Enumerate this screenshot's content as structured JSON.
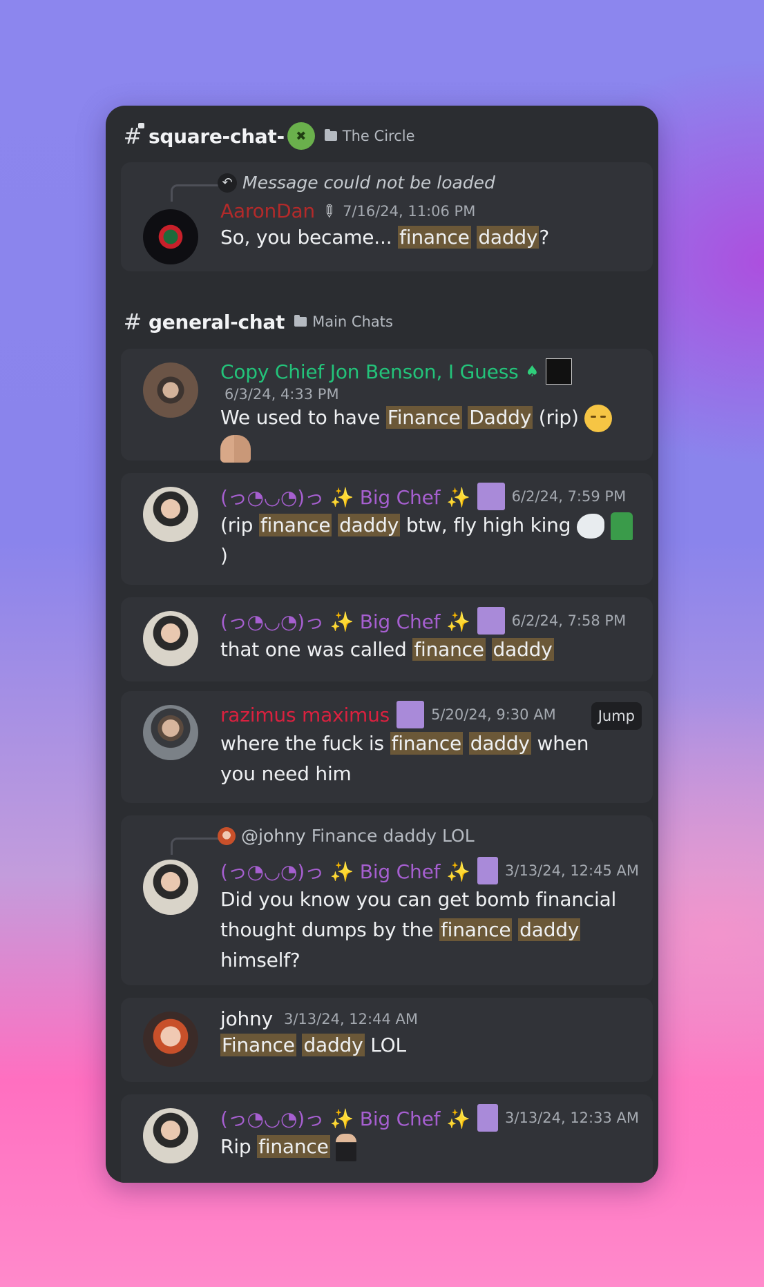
{
  "section1": {
    "channel": "square-chat-",
    "category": "The Circle",
    "message": {
      "reply_notice": "Message could not be loaded",
      "username": "AaronDan",
      "username_color": "#b32a2a",
      "timestamp": "7/16/24, 11:06 PM",
      "text_pre": "So, you became... ",
      "hl1": "finance",
      "hl2": "daddy",
      "text_post": "?"
    }
  },
  "section2": {
    "channel": "general-chat",
    "category": "Main Chats",
    "messages": [
      {
        "username": "Copy Chief Jon Benson, I Guess",
        "username_color": "#23c37a",
        "timestamp": "6/3/24, 4:33 PM",
        "text_pre": "We used to have ",
        "hl1": "Finance",
        "hl2": "Daddy",
        "text_post": " (rip) "
      },
      {
        "username": "(っ◔◡◔)っ ✨ Big Chef ✨",
        "username_color": "#a65fd0",
        "timestamp": "6/2/24, 7:59 PM",
        "text_pre": "(rip ",
        "hl1": "finance",
        "hl2": "daddy",
        "text_post": " btw, fly high king ",
        "text_tail": ")"
      },
      {
        "username": "(っ◔◡◔)っ ✨ Big Chef ✨",
        "username_color": "#a65fd0",
        "timestamp": "6/2/24, 7:58 PM",
        "text_pre": "that one was called ",
        "hl1": "finance",
        "hl2": "daddy",
        "text_post": ""
      },
      {
        "username": "razimus maximus",
        "username_color": "#d9213f",
        "timestamp": "5/20/24, 9:30 AM",
        "jump_label": "Jump",
        "text_pre": "where the fuck is ",
        "hl1": "finance",
        "hl2": "daddy",
        "text_post": " when you need him"
      },
      {
        "reply_user": "@johny",
        "reply_text": "Finance daddy LOL",
        "username": "(っ◔◡◔)っ ✨ Big Chef ✨",
        "username_color": "#a65fd0",
        "timestamp": "3/13/24, 12:45 AM",
        "text_pre": "Did you know you can get bomb financial thought dumps by the ",
        "hl1": "finance",
        "hl2": "daddy",
        "text_post": " himself?"
      },
      {
        "username": "johny",
        "username_color": "#f2f3f5",
        "timestamp": "3/13/24, 12:44 AM",
        "text_pre": "",
        "hl1": "Finance",
        "hl2": "daddy",
        "text_post": " LOL"
      },
      {
        "username": "(っ◔◡◔)っ ✨ Big Chef ✨",
        "username_color": "#a65fd0",
        "timestamp": "3/13/24, 12:33 AM",
        "text_pre": "Rip ",
        "hl1": "finance",
        "text_post": " "
      }
    ]
  }
}
